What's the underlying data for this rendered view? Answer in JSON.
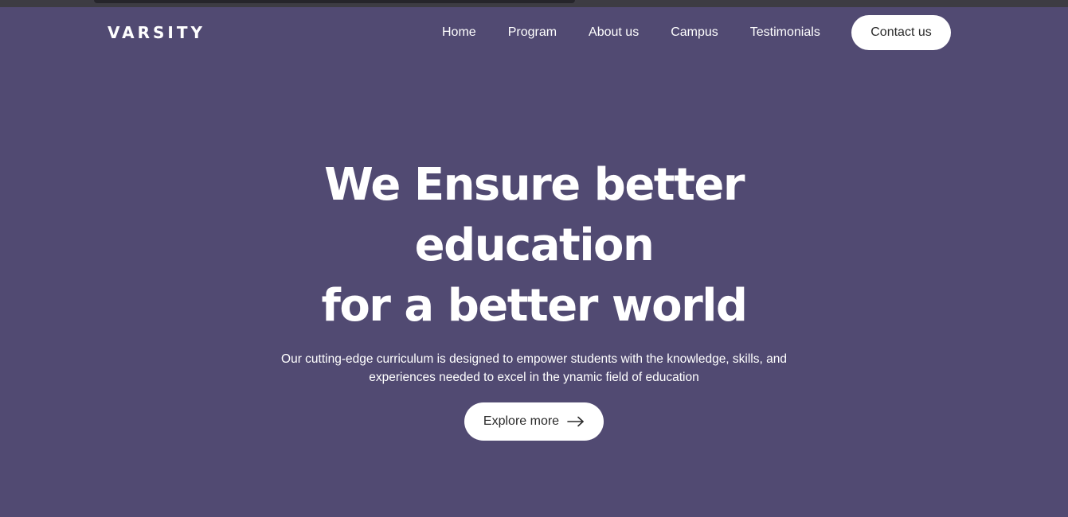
{
  "navbar": {
    "logo": "VARSITY",
    "links": [
      {
        "label": "Home"
      },
      {
        "label": "Program"
      },
      {
        "label": "About us"
      },
      {
        "label": "Campus"
      },
      {
        "label": "Testimonials"
      }
    ],
    "contact_label": "Contact us"
  },
  "hero": {
    "title_line1": "We Ensure better education",
    "title_line2": "for a better world",
    "subtitle": "Our cutting-edge curriculum is designed to empower students with the knowledge, skills, and experiences needed to excel in the ynamic field of education",
    "button_label": "Explore more",
    "button_icon": "arrow-right-icon"
  },
  "colors": {
    "background": "#514a72",
    "button_bg": "#ffffff",
    "button_text": "#2a2a2a"
  }
}
